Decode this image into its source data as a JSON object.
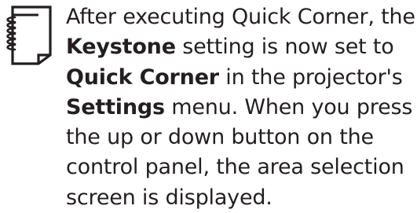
{
  "note": {
    "icon": "memo-notepad-icon",
    "text_color": "#231f20",
    "segments": [
      {
        "text": "After executing Quick Corner, the ",
        "bold": false
      },
      {
        "text": "Keystone",
        "bold": true
      },
      {
        "text": " setting is now set to ",
        "bold": false
      },
      {
        "text": "Quick Corner",
        "bold": true
      },
      {
        "text": " in the projector's ",
        "bold": false
      },
      {
        "text": "Settings",
        "bold": true
      },
      {
        "text": " menu. When you press the up or down button on the control panel, the area selection screen is displayed.",
        "bold": false
      }
    ]
  }
}
